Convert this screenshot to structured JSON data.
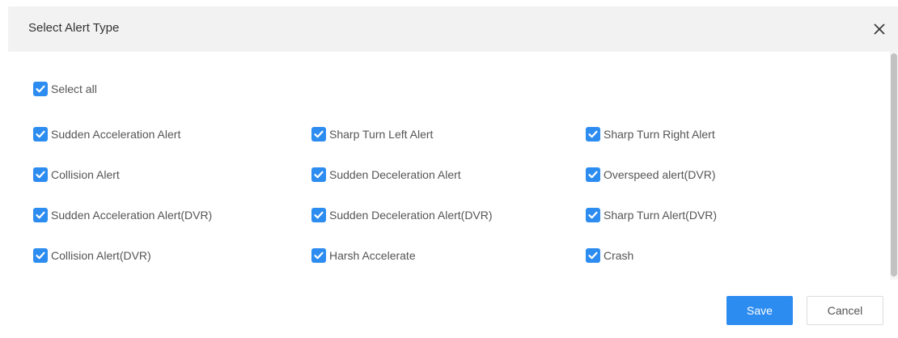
{
  "dialog": {
    "title": "Select Alert Type",
    "close_icon": "close-icon"
  },
  "select_all": {
    "label": "Select all",
    "checked": true
  },
  "alert_types": [
    {
      "label": "Sudden Acceleration Alert",
      "checked": true
    },
    {
      "label": "Sharp Turn Left Alert",
      "checked": true
    },
    {
      "label": "Sharp Turn Right Alert",
      "checked": true
    },
    {
      "label": "Collision Alert",
      "checked": true
    },
    {
      "label": "Sudden Deceleration Alert",
      "checked": true
    },
    {
      "label": "Overspeed alert(DVR)",
      "checked": true
    },
    {
      "label": "Sudden Acceleration Alert(DVR)",
      "checked": true
    },
    {
      "label": "Sudden Deceleration Alert(DVR)",
      "checked": true
    },
    {
      "label": "Sharp Turn Alert(DVR)",
      "checked": true
    },
    {
      "label": "Collision Alert(DVR)",
      "checked": true
    },
    {
      "label": "Harsh Accelerate",
      "checked": true
    },
    {
      "label": "Crash",
      "checked": true
    }
  ],
  "footer": {
    "save_label": "Save",
    "cancel_label": "Cancel"
  },
  "colors": {
    "accent": "#2d8cf0",
    "header_bg": "#f2f2f2",
    "text": "#555555"
  }
}
